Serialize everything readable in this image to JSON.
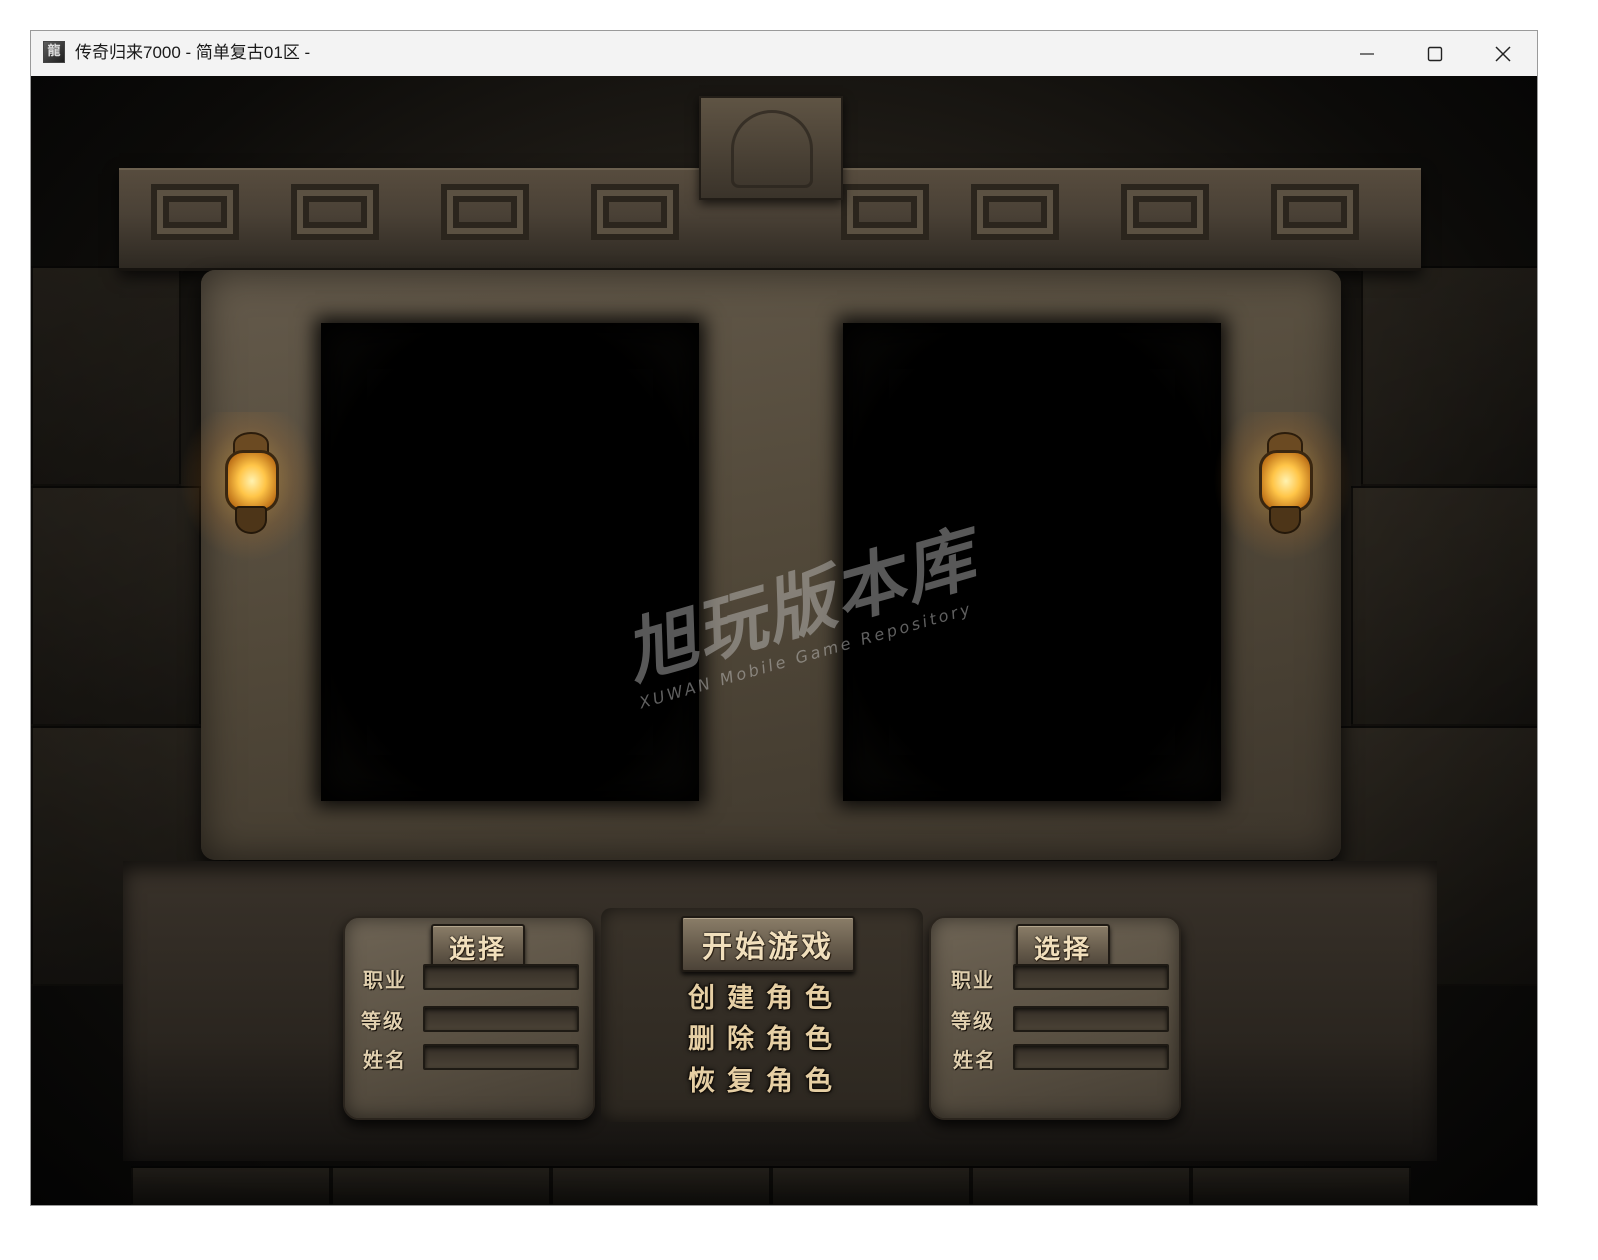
{
  "window": {
    "title": "传奇归来7000 - 简单复古01区 -",
    "icon": "game-app-icon",
    "icon_glyph": "龍",
    "controls": {
      "minimize": "minimize-icon",
      "maximize": "maximize-icon",
      "close": "close-icon"
    }
  },
  "scene": {
    "watermark": {
      "main": "旭玩版本库",
      "sub": "XUWAN Mobile Game Repository"
    }
  },
  "left_slot": {
    "select_label": "选择",
    "fields": [
      {
        "label": "职业",
        "value": ""
      },
      {
        "label": "等级",
        "value": ""
      },
      {
        "label": "姓名",
        "value": ""
      }
    ]
  },
  "right_slot": {
    "select_label": "选择",
    "fields": [
      {
        "label": "职业",
        "value": ""
      },
      {
        "label": "等级",
        "value": ""
      },
      {
        "label": "姓名",
        "value": ""
      }
    ]
  },
  "center_menu": {
    "start_label": "开始游戏",
    "create_label": "创建角色",
    "delete_label": "删除角色",
    "restore_label": "恢复角色"
  },
  "colors": {
    "titlebar": "#f3f3f3",
    "stone": "#5a5143",
    "button_text": "#f1dfbc",
    "lantern_glow": "#ffc548"
  }
}
